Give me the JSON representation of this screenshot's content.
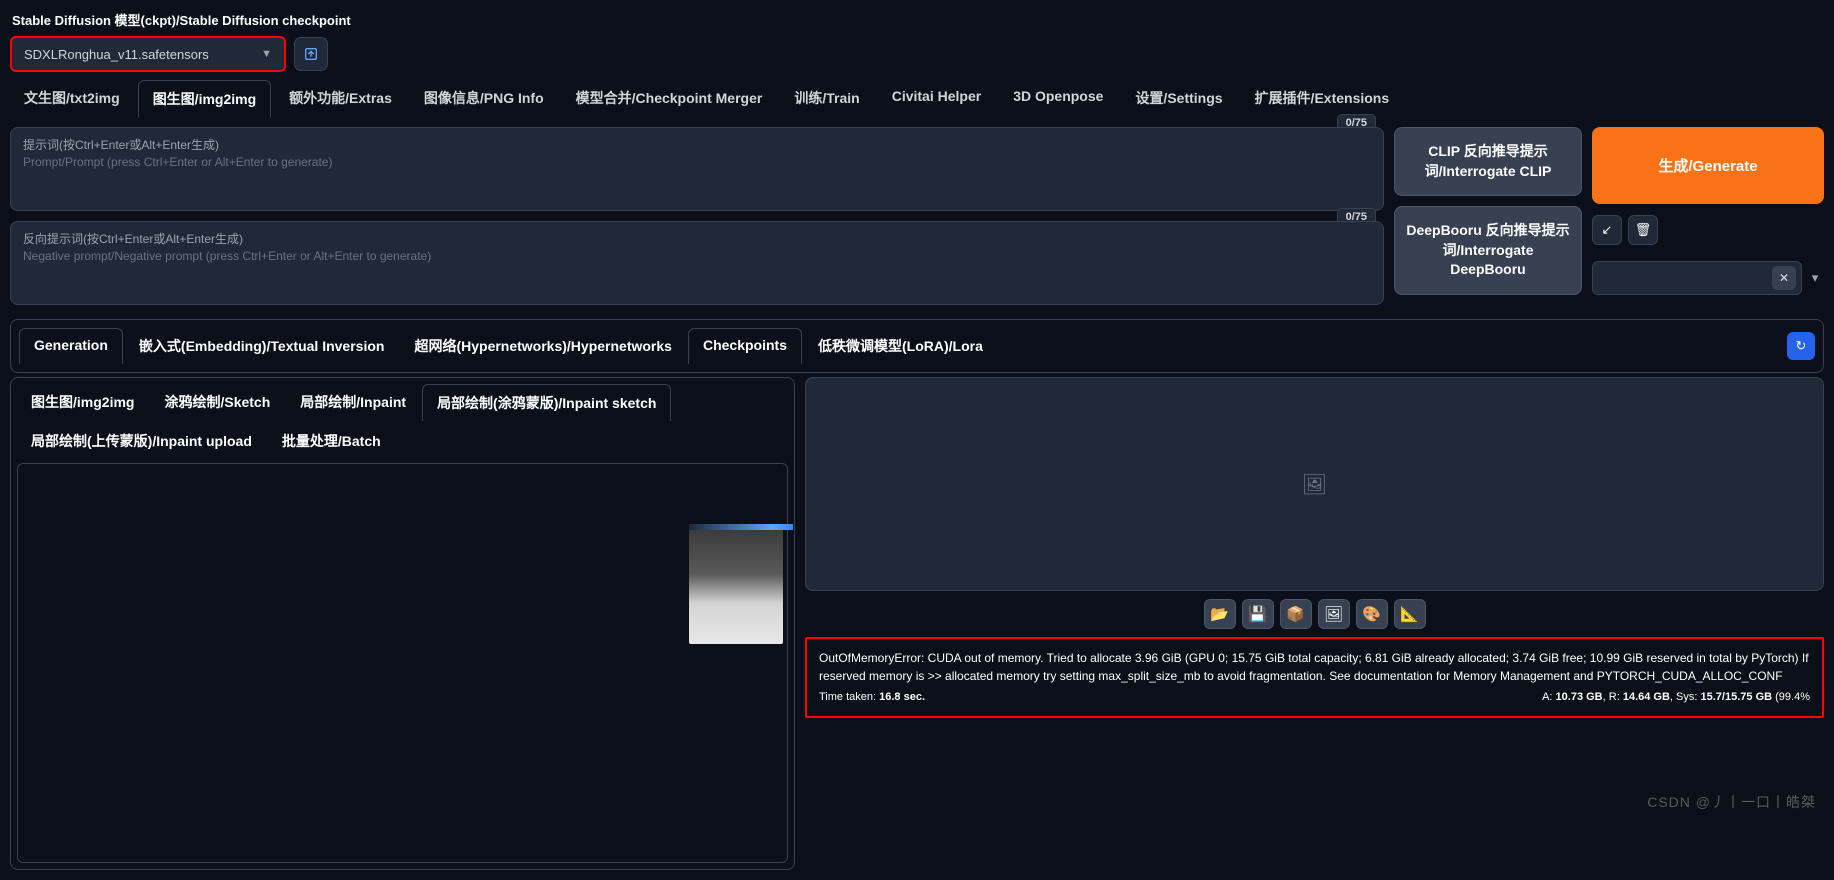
{
  "header": {
    "label": "Stable Diffusion 模型(ckpt)/Stable Diffusion checkpoint"
  },
  "checkpoint": {
    "selected": "SDXLRonghua_v11.safetensors"
  },
  "tabs": [
    "文生图/txt2img",
    "图生图/img2img",
    "额外功能/Extras",
    "图像信息/PNG Info",
    "模型合并/Checkpoint Merger",
    "训练/Train",
    "Civitai Helper",
    "3D Openpose",
    "设置/Settings",
    "扩展插件/Extensions"
  ],
  "active_tab": 1,
  "counters": {
    "prompt": "0/75",
    "negative": "0/75"
  },
  "prompt": {
    "label_zh": "提示词(按Ctrl+Enter或Alt+Enter生成)",
    "label_en": "Prompt/Prompt (press Ctrl+Enter or Alt+Enter to generate)"
  },
  "negative": {
    "label_zh": "反向提示词(按Ctrl+Enter或Alt+Enter生成)",
    "label_en": "Negative prompt/Negative prompt (press Ctrl+Enter or Alt+Enter to generate)"
  },
  "interrogate": {
    "clip": "CLIP 反向推导提示词/Interrogate CLIP",
    "deepbooru": "DeepBooru 反向推导提示词/Interrogate DeepBooru"
  },
  "generate": {
    "label": "生成/Generate"
  },
  "subtabs": [
    "Generation",
    "嵌入式(Embedding)/Textual Inversion",
    "超网络(Hypernetworks)/Hypernetworks",
    "Checkpoints",
    "低秩微调模型(LoRA)/Lora"
  ],
  "img_tabs": [
    "图生图/img2img",
    "涂鸦绘制/Sketch",
    "局部绘制/Inpaint",
    "局部绘制(涂鸦蒙版)/Inpaint sketch",
    "局部绘制(上传蒙版)/Inpaint upload",
    "批量处理/Batch"
  ],
  "active_img_tab": 3,
  "error": {
    "text": "OutOfMemoryError: CUDA out of memory. Tried to allocate 3.96 GiB (GPU 0; 15.75 GiB total capacity; 6.81 GiB already allocated; 3.74 GiB free; 10.99 GiB reserved in total by PyTorch) If reserved memory is >> allocated memory try setting max_split_size_mb to avoid fragmentation. See documentation for Memory Management and PYTORCH_CUDA_ALLOC_CONF",
    "time_label": "Time taken:",
    "time": "16.8 sec.",
    "stats_a": "A:",
    "stats_a_v": "10.73 GB",
    "stats_r": "R:",
    "stats_r_v": "14.64 GB",
    "stats_sys": "Sys:",
    "stats_sys_v": "15.7/15.75 GB",
    "stats_pct": "(99.4%"
  },
  "watermark": "CSDN @丿丨一口丨皓桀"
}
